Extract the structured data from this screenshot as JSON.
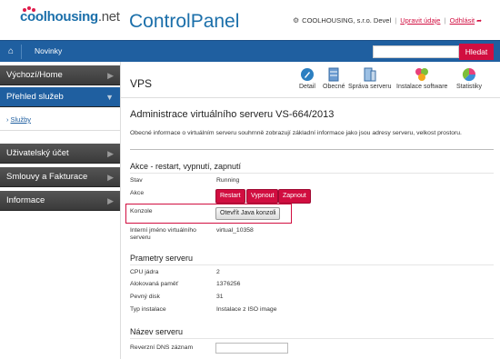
{
  "header": {
    "logo_brand": "coolhousing",
    "logo_tld": ".net",
    "app_title": "ControlPanel",
    "user_name": "COOLHOUSING, s.r.o. Devel",
    "edit_link": "Upravit údaje",
    "logout_link": "Odhlásit",
    "user_icon": "user-icon",
    "logout_icon": "logout-icon"
  },
  "topbar": {
    "home_icon": "home-icon",
    "news_label": "Novinky",
    "search_placeholder": "",
    "search_button": "Hledat"
  },
  "sidebar": {
    "items": [
      {
        "label": "Výchozí/Home"
      },
      {
        "label": "Přehled služeb"
      },
      {
        "label": "Uživatelský účet"
      },
      {
        "label": "Smlouvy a Fakturace"
      },
      {
        "label": "Informace"
      }
    ],
    "sub_items": [
      {
        "label": "Služby"
      }
    ]
  },
  "main": {
    "page_title": "VPS",
    "toolbar": [
      {
        "label": "Detail",
        "icon": "pencil-icon"
      },
      {
        "label": "Obecné",
        "icon": "server-icon"
      },
      {
        "label": "Správa serveru",
        "icon": "server-manage-icon"
      },
      {
        "label": "Instalace software",
        "icon": "software-icon"
      },
      {
        "label": "Statistiky",
        "icon": "stats-icon"
      }
    ],
    "content_title": "Administrace virtuálního serveru VS-664/2013",
    "description": "Obecné informace o virtuálním serveru souhrnně zobrazují základní informace jako jsou adresy serveru, velkost prostoru.",
    "section_actions": "Akce - restart, vypnutí, zapnutí",
    "status_label": "Stav",
    "status_value": "Running",
    "actions_label": "Akce",
    "btn_restart": "Restart",
    "btn_off": "Vypnout",
    "btn_on": "Zapnout",
    "console_label": "Konzole",
    "console_button": "Otevřít Java konzoli",
    "internal_name_label": "Interní jméno virtuálního serveru",
    "internal_name_value": "virtual_10358",
    "section_params": "Prametry serveru",
    "params": [
      {
        "label": "CPU jádra",
        "value": "2"
      },
      {
        "label": "Alokovaná paměť",
        "value": "1376256"
      },
      {
        "label": "Pevný disk",
        "value": "31"
      },
      {
        "label": "Typ instalace",
        "value": "Instalace z ISO image"
      }
    ],
    "section_name": "Název serveru",
    "dns_label": "Reverzní DNS záznam",
    "dns_value": ""
  }
}
